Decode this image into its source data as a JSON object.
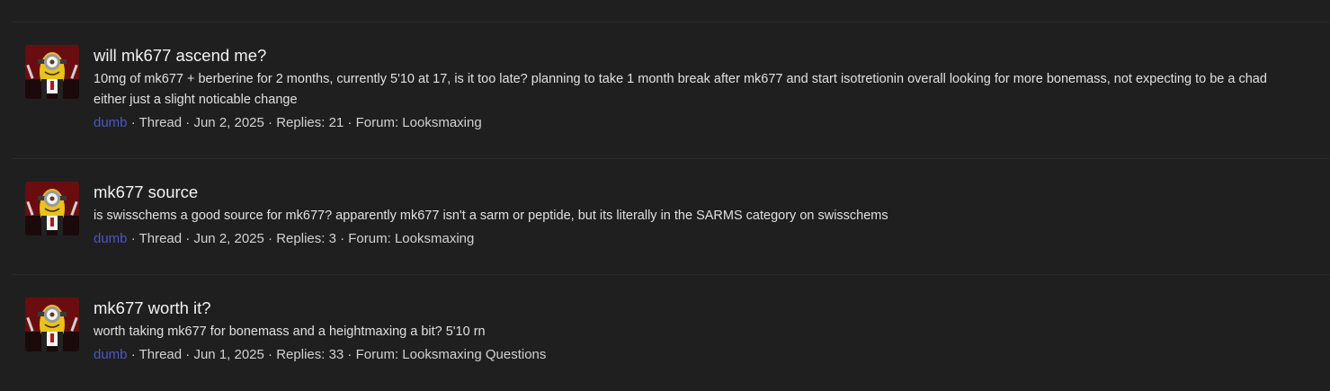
{
  "results": [
    {
      "title": "will mk677 ascend me?",
      "snippet": "10mg of mk677 + berberine for 2 months, currently 5'10 at 17, is it too late? planning to take 1 month break after mk677 and start isotretionin overall looking for more bonemass, not expecting to be a chad either just a slight noticable change",
      "author": "dumb",
      "type": "Thread",
      "date": "Jun 2, 2025",
      "replies": "Replies: 21",
      "forum_label": "Forum:",
      "forum": "Looksmaxing",
      "separator": " · "
    },
    {
      "title": "mk677 source",
      "snippet": "is swisschems a good source for mk677? apparently mk677 isn't a sarm or peptide, but its literally in the SARMS category on swisschems",
      "author": "dumb",
      "type": "Thread",
      "date": "Jun 2, 2025",
      "replies": "Replies: 3",
      "forum_label": "Forum:",
      "forum": "Looksmaxing",
      "separator": " · "
    },
    {
      "title": "mk677 worth it?",
      "snippet": "worth taking mk677 for bonemass and a heightmaxing a bit? 5'10 rn",
      "author": "dumb",
      "type": "Thread",
      "date": "Jun 1, 2025",
      "replies": "Replies: 33",
      "forum_label": "Forum:",
      "forum": "Looksmaxing Questions",
      "separator": " · "
    }
  ],
  "colors": {
    "background": "#1f1f20",
    "divider": "#2b2b2c",
    "username": "#4c57c2",
    "title": "#f2f2f2"
  },
  "icons": {
    "avatar": "minion-avatar-icon"
  }
}
